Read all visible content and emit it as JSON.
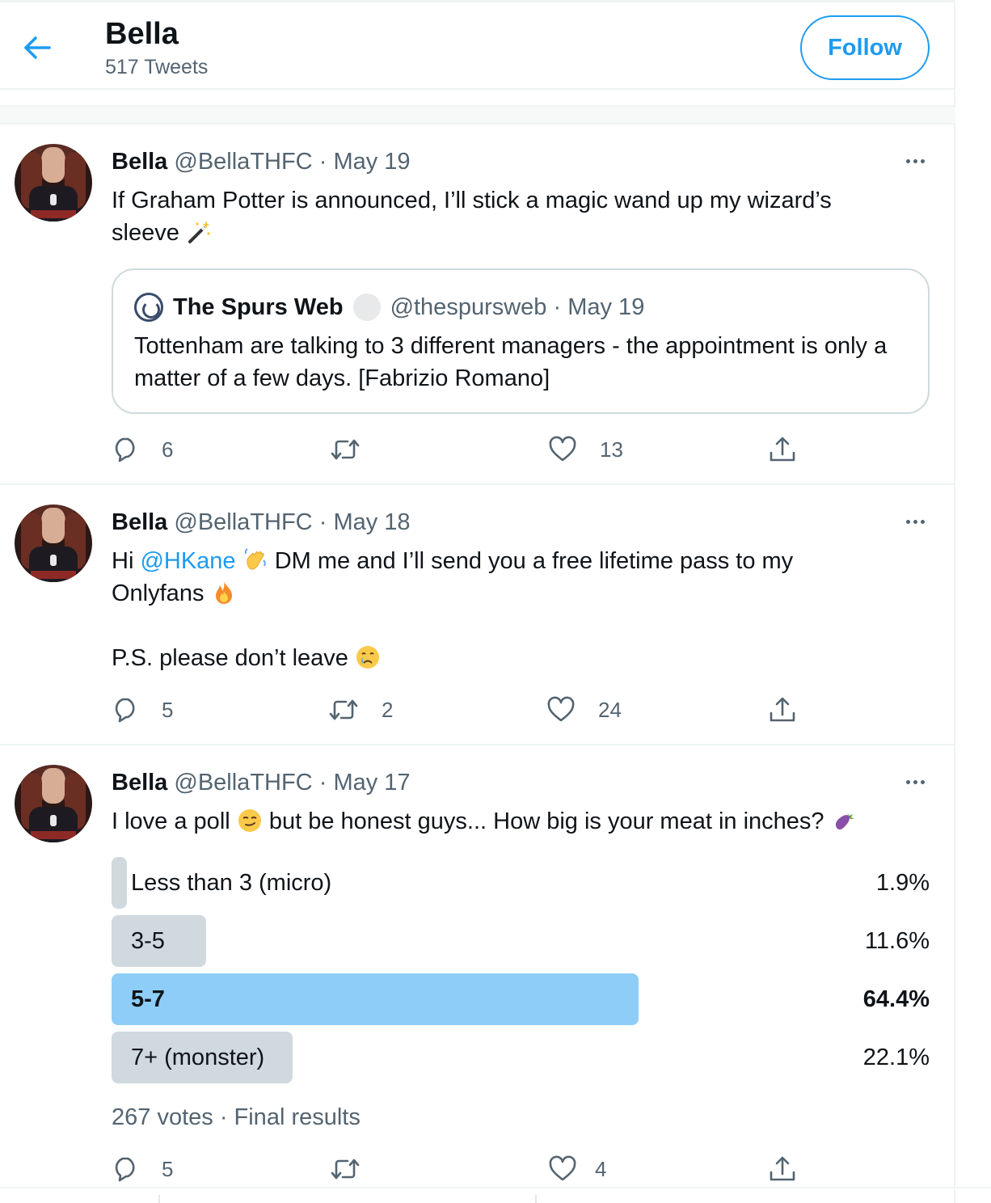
{
  "profile": {
    "name": "Bella",
    "tweet_count": "517 Tweets",
    "follow_label": "Follow"
  },
  "colors": {
    "accent": "#1d9bf0",
    "secondary_text": "#536471",
    "poll_bar": "#cfd9de",
    "poll_bar_winner": "#8ecdf8"
  },
  "tweets": [
    {
      "display_name": "Bella",
      "handle": "@BellaTHFC",
      "date": "May 19",
      "text_parts": [
        "If Graham Potter is announced, I’ll stick a magic wand up my wizard’s",
        "sleeve"
      ],
      "emoji": [
        "magic-wand-emoji"
      ],
      "quote": {
        "display_name": "The Spurs Web",
        "handle": "@thespursweb",
        "date": "May 19",
        "text": "Tottenham are talking to 3 different managers - the appointment is only a matter of a few days. [Fabrizio Romano]"
      },
      "actions": {
        "reply": "6",
        "retweet": "",
        "like": "13"
      }
    },
    {
      "display_name": "Bella",
      "handle": "@BellaTHFC",
      "date": "May 18",
      "text_parts": [
        "Hi",
        "@HKane",
        "DM me and I’ll send you a free lifetime pass to my",
        "Onlyfans",
        "P.S. please don’t leave"
      ],
      "emoji": [
        "waving-hand-emoji",
        "fire-emoji",
        "crying-face-emoji"
      ],
      "actions": {
        "reply": "5",
        "retweet": "2",
        "like": "24"
      }
    },
    {
      "display_name": "Bella",
      "handle": "@BellaTHFC",
      "date": "May 17",
      "text_parts": [
        "I love a poll",
        "but be honest guys... How big is your meat in inches?"
      ],
      "emoji": [
        "smirking-face-emoji",
        "eggplant-emoji"
      ],
      "poll": {
        "options": [
          {
            "label": "Less than 3 (micro)",
            "percent_text": "1.9%",
            "percent": 1.9,
            "winner": false
          },
          {
            "label": "3-5",
            "percent_text": "11.6%",
            "percent": 11.6,
            "winner": false
          },
          {
            "label": "5-7",
            "percent_text": "64.4%",
            "percent": 64.4,
            "winner": true
          },
          {
            "label": "7+ (monster)",
            "percent_text": "22.1%",
            "percent": 22.1,
            "winner": false
          }
        ],
        "footer": "267 votes · Final results"
      },
      "actions": {
        "reply": "5",
        "retweet": "",
        "like": "4"
      }
    }
  ]
}
